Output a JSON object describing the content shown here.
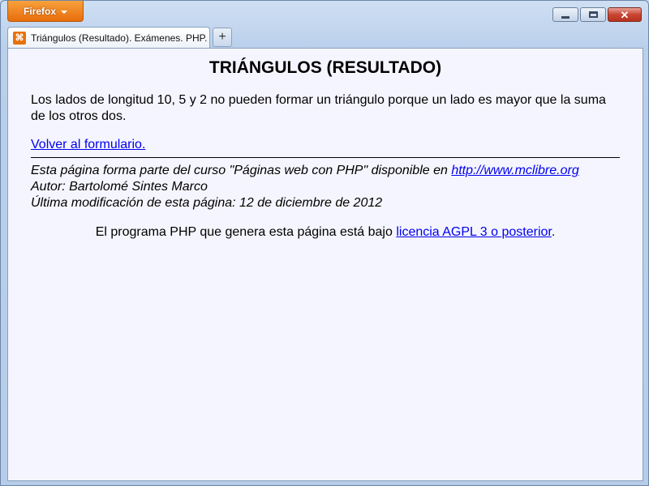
{
  "browser": {
    "app_button": "Firefox",
    "tab_title": "Triángulos (Resultado). Exámenes. PHP. ...",
    "new_tab": "+",
    "close_glyph": "✕"
  },
  "page": {
    "heading": "TRIÁNGULOS (RESULTADO)",
    "message": "Los lados de longitud 10, 5 y 2 no pueden formar un triángulo porque un lado es mayor que la suma de los otros dos.",
    "back_link": "Volver al formulario.",
    "footer": {
      "course_text": "Esta página forma parte del curso \"Páginas web con PHP\" disponible en ",
      "course_link": "http://www.mclibre.org",
      "author": "Autor: Bartolomé Sintes Marco",
      "modified": "Última modificación de esta página: 12 de diciembre de 2012"
    },
    "license": {
      "text": "El programa PHP que genera esta página está bajo ",
      "link": "licencia AGPL 3 o posterior",
      "end": "."
    }
  },
  "colors": {
    "firefox_orange": "#e86c0c",
    "page_background": "#f5f5ff",
    "link": "#0000ee"
  }
}
